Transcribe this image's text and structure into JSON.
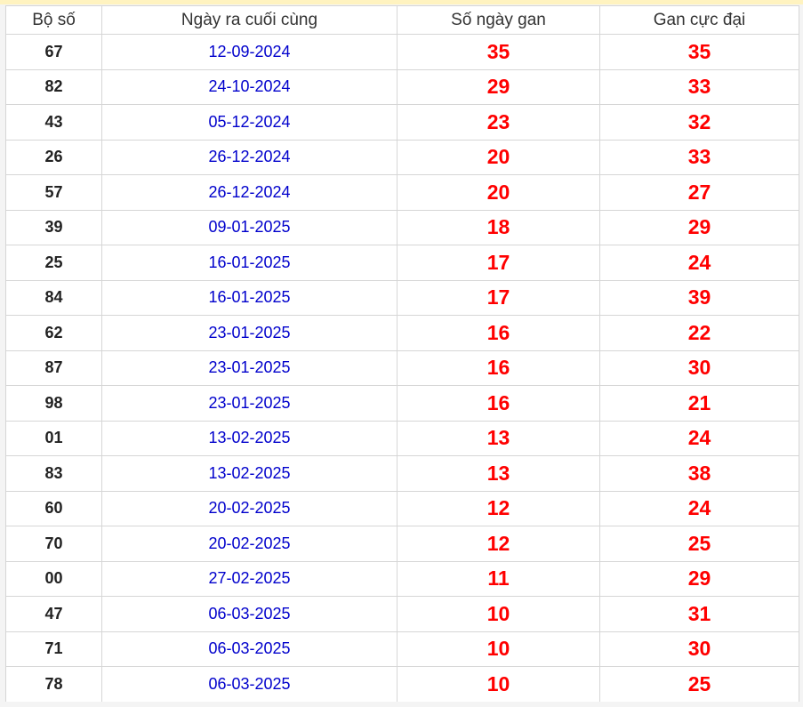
{
  "table": {
    "headers": [
      "Bộ số",
      "Ngày ra cuối cùng",
      "Số ngày gan",
      "Gan cực đại"
    ],
    "rows": [
      {
        "number": "67",
        "last_date": "12-09-2024",
        "days_gan": "35",
        "max_gan": "35"
      },
      {
        "number": "82",
        "last_date": "24-10-2024",
        "days_gan": "29",
        "max_gan": "33"
      },
      {
        "number": "43",
        "last_date": "05-12-2024",
        "days_gan": "23",
        "max_gan": "32"
      },
      {
        "number": "26",
        "last_date": "26-12-2024",
        "days_gan": "20",
        "max_gan": "33"
      },
      {
        "number": "57",
        "last_date": "26-12-2024",
        "days_gan": "20",
        "max_gan": "27"
      },
      {
        "number": "39",
        "last_date": "09-01-2025",
        "days_gan": "18",
        "max_gan": "29"
      },
      {
        "number": "25",
        "last_date": "16-01-2025",
        "days_gan": "17",
        "max_gan": "24"
      },
      {
        "number": "84",
        "last_date": "16-01-2025",
        "days_gan": "17",
        "max_gan": "39"
      },
      {
        "number": "62",
        "last_date": "23-01-2025",
        "days_gan": "16",
        "max_gan": "22"
      },
      {
        "number": "87",
        "last_date": "23-01-2025",
        "days_gan": "16",
        "max_gan": "30"
      },
      {
        "number": "98",
        "last_date": "23-01-2025",
        "days_gan": "16",
        "max_gan": "21"
      },
      {
        "number": "01",
        "last_date": "13-02-2025",
        "days_gan": "13",
        "max_gan": "24"
      },
      {
        "number": "83",
        "last_date": "13-02-2025",
        "days_gan": "13",
        "max_gan": "38"
      },
      {
        "number": "60",
        "last_date": "20-02-2025",
        "days_gan": "12",
        "max_gan": "24"
      },
      {
        "number": "70",
        "last_date": "20-02-2025",
        "days_gan": "12",
        "max_gan": "25"
      },
      {
        "number": "00",
        "last_date": "27-02-2025",
        "days_gan": "11",
        "max_gan": "29"
      },
      {
        "number": "47",
        "last_date": "06-03-2025",
        "days_gan": "10",
        "max_gan": "31"
      },
      {
        "number": "71",
        "last_date": "06-03-2025",
        "days_gan": "10",
        "max_gan": "30"
      },
      {
        "number": "78",
        "last_date": "06-03-2025",
        "days_gan": "10",
        "max_gan": "25"
      }
    ]
  },
  "colors": {
    "header_bar": "#fff3c0",
    "date_text": "#0000cc",
    "gan_text": "#ff0000",
    "border": "#d6d6d6"
  }
}
